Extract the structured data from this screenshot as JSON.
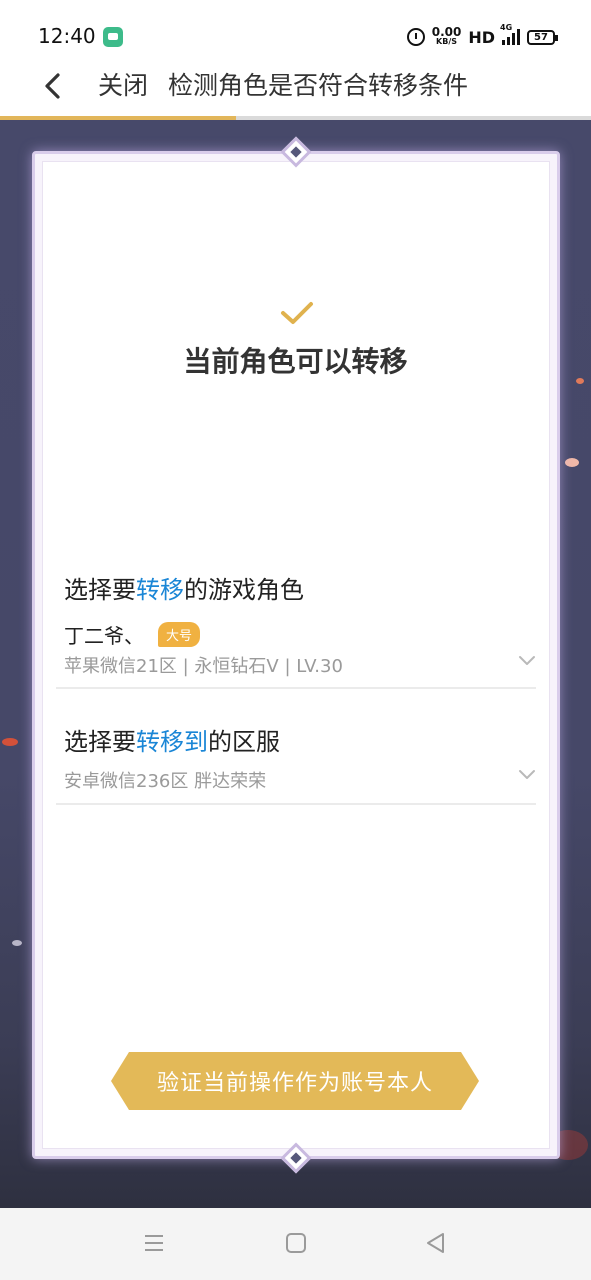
{
  "status_bar": {
    "time": "12:40",
    "speed_value": "0.00",
    "speed_unit": "KB/S",
    "hd": "HD",
    "network": "4G",
    "battery": "57"
  },
  "nav": {
    "close_label": "关闭",
    "title": "检测角色是否符合转移条件",
    "progress_percent": 40
  },
  "result": {
    "title": "当前角色可以转移"
  },
  "source_section": {
    "label_prefix": "选择要",
    "label_highlight": "转移",
    "label_suffix": "的游戏角色",
    "role_name": "丁二爷、",
    "badge": "大号",
    "details": "苹果微信21区 | 永恒钻石V | LV.30"
  },
  "target_section": {
    "label_prefix": "选择要",
    "label_highlight": "转移到",
    "label_suffix": "的区服",
    "details": "安卓微信236区 胖达荣荣"
  },
  "actions": {
    "verify_label": "验证当前操作作为账号本人"
  },
  "colors": {
    "accent_gold": "#e3b958",
    "highlight_blue": "#1a86d6",
    "background_purple": "#47496a"
  }
}
